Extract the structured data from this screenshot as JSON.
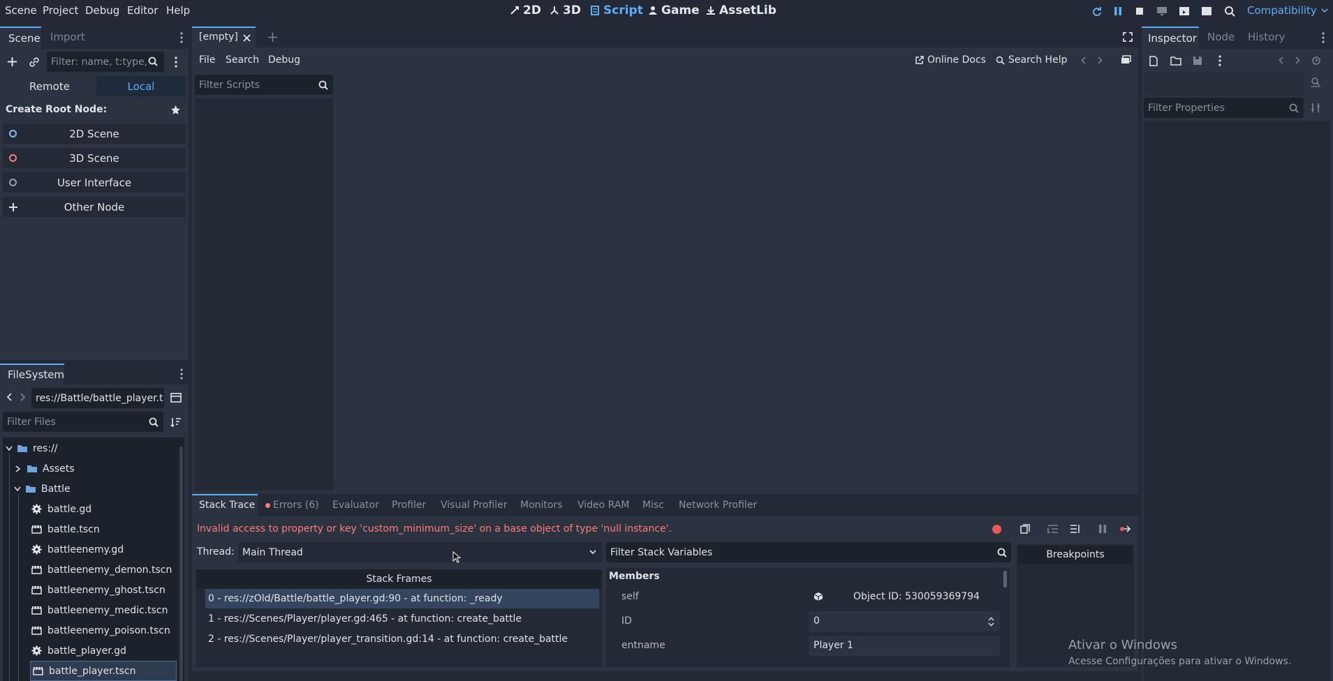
{
  "menu": [
    "Scene",
    "Project",
    "Debug",
    "Editor",
    "Help"
  ],
  "modes": [
    {
      "label": "2D",
      "icon": "2d-icon"
    },
    {
      "label": "3D",
      "icon": "3d-icon"
    },
    {
      "label": "Script",
      "icon": "script-icon"
    },
    {
      "label": "Game",
      "icon": "game-icon"
    },
    {
      "label": "AssetLib",
      "icon": "assetlib-icon"
    }
  ],
  "renderer": "Compatibility",
  "scene_dock": {
    "tabs": [
      "Scene",
      "Import"
    ],
    "filter_placeholder": "Filter: name, t:type,",
    "remote": "Remote",
    "local": "Local",
    "create_root": "Create Root Node:",
    "options": [
      "2D Scene",
      "3D Scene",
      "User Interface",
      "Other Node"
    ]
  },
  "filesystem": {
    "tab": "FileSystem",
    "path": "res://Battle/battle_player.t",
    "filter_placeholder": "Filter Files",
    "tree": [
      {
        "label": "res://",
        "type": "folder",
        "indent": 0,
        "arrow": "down"
      },
      {
        "label": "Assets",
        "type": "folder",
        "indent": 1,
        "arrow": "right"
      },
      {
        "label": "Battle",
        "type": "folder",
        "indent": 1,
        "arrow": "down"
      },
      {
        "label": "battle.gd",
        "type": "script",
        "indent": 2
      },
      {
        "label": "battle.tscn",
        "type": "scene",
        "indent": 2
      },
      {
        "label": "battleenemy.gd",
        "type": "script",
        "indent": 2
      },
      {
        "label": "battleenemy_demon.tscn",
        "type": "scene",
        "indent": 2
      },
      {
        "label": "battleenemy_ghost.tscn",
        "type": "scene",
        "indent": 2
      },
      {
        "label": "battleenemy_medic.tscn",
        "type": "scene",
        "indent": 2
      },
      {
        "label": "battleenemy_poison.tscn",
        "type": "scene",
        "indent": 2
      },
      {
        "label": "battle_player.gd",
        "type": "script",
        "indent": 2
      },
      {
        "label": "battle_player.tscn",
        "type": "scene",
        "indent": 2,
        "selected": true
      }
    ]
  },
  "script_editor": {
    "tab": "[empty]",
    "menu": [
      "File",
      "Search",
      "Debug"
    ],
    "online_docs": "Online Docs",
    "search_help": "Search Help",
    "filter_scripts": "Filter Scripts"
  },
  "inspector": {
    "tabs": [
      "Inspector",
      "Node",
      "History"
    ],
    "filter_placeholder": "Filter Properties"
  },
  "debugger": {
    "tabs": [
      "Stack Trace",
      "Errors (6)",
      "Evaluator",
      "Profiler",
      "Visual Profiler",
      "Monitors",
      "Video RAM",
      "Misc",
      "Network Profiler"
    ],
    "error": "Invalid access to property or key 'custom_minimum_size' on a base object of type 'null instance'.",
    "thread_label": "Thread:",
    "thread_value": "Main Thread",
    "stack_frames_title": "Stack Frames",
    "frames": [
      "0 - res://zOld/Battle/battle_player.gd:90 - at function: _ready",
      "1 - res://Scenes/Player/player.gd:465 - at function: create_battle",
      "2 - res://Scenes/Player/player_transition.gd:14 - at function: create_battle"
    ],
    "filter_vars": "Filter Stack Variables",
    "members_title": "Members",
    "members": [
      {
        "name": "self",
        "value": "Object ID: 530059369794"
      },
      {
        "name": "ID",
        "value": "0"
      },
      {
        "name": "entname",
        "value": "Player 1"
      }
    ],
    "breakpoints": "Breakpoints"
  },
  "watermark": {
    "title": "Ativar o Windows",
    "subtitle": "Acesse Configurações para ativar o Windows."
  },
  "colors": {
    "accent": "#5aaef6",
    "error": "#ff7a7a",
    "bg": "#232a35",
    "panel": "#2b3340"
  }
}
